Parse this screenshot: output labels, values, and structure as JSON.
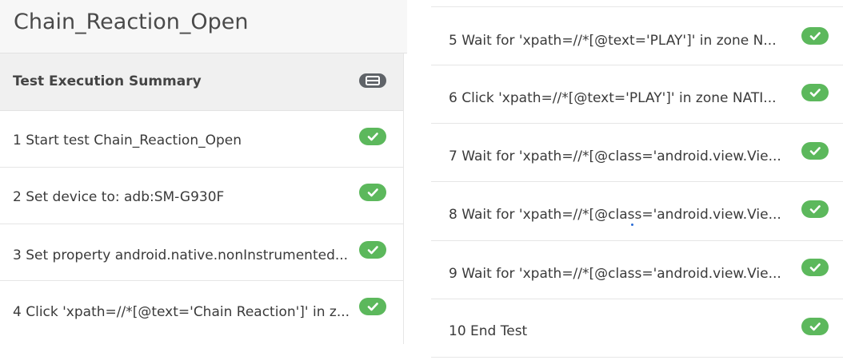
{
  "page_title": "Chain_Reaction_Open",
  "summary": {
    "label": "Test Execution Summary",
    "icon": "layout-toggle-icon"
  },
  "colors": {
    "success": "#5cb85c",
    "summary_icon": "#5f6368"
  },
  "left_steps": [
    {
      "text": "1 Start test Chain_Reaction_Open",
      "status": "passed"
    },
    {
      "text": "2 Set device to: adb:SM-G930F",
      "status": "passed"
    },
    {
      "text": "3 Set property android.native.nonInstrumented...",
      "status": "passed"
    },
    {
      "text": "4 Click 'xpath=//*[@text='Chain Reaction']' in z...",
      "status": "passed"
    }
  ],
  "right_steps": [
    {
      "text": "5 Wait for 'xpath=//*[@text='PLAY']' in zone N...",
      "status": "passed"
    },
    {
      "text": "6 Click 'xpath=//*[@text='PLAY']' in zone NATI...",
      "status": "passed"
    },
    {
      "text": "7 Wait for 'xpath=//*[@class='android.view.Vie...",
      "status": "passed"
    },
    {
      "text": "8 Wait for 'xpath=//*[@class='android.view.Vie...",
      "status": "passed"
    },
    {
      "text": "9 Wait for 'xpath=//*[@class='android.view.Vie...",
      "status": "passed"
    },
    {
      "text": "10 End Test",
      "status": "passed"
    }
  ]
}
